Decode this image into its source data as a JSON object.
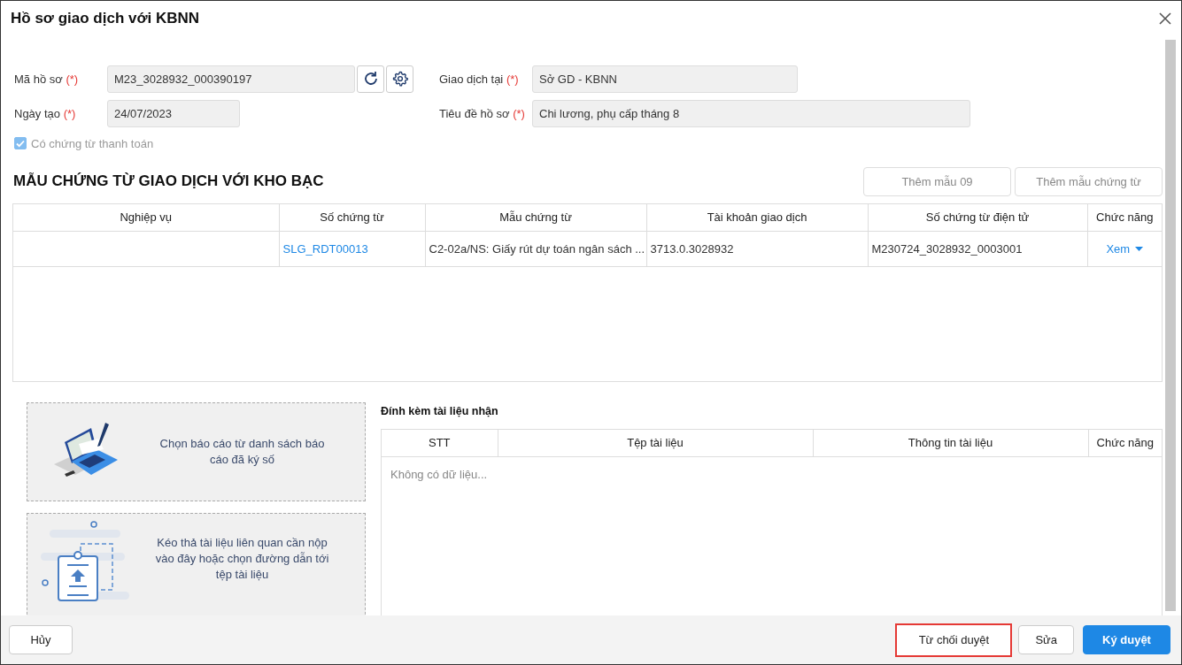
{
  "dialog": {
    "title": "Hồ sơ giao dịch với KBNN"
  },
  "form": {
    "fields": [
      {
        "label": "Mã hồ sơ",
        "required_mark": "(*)",
        "value": "M23_3028932_000390197",
        "kind": "with_actions"
      },
      {
        "label": "Giao dịch tại",
        "required_mark": "(*)",
        "value": "Sở GD - KBNN",
        "kind": "plain"
      },
      {
        "label": "Ngày tạo",
        "required_mark": "(*)",
        "value": "24/07/2023",
        "kind": "plain"
      },
      {
        "label": "Tiêu đề hồ sơ",
        "required_mark": "(*)",
        "value": "Chi lương, phụ cấp tháng 8",
        "kind": "plain"
      }
    ],
    "checkbox": {
      "label": "Có chứng từ thanh toán",
      "checked": true,
      "disabled": true
    }
  },
  "section": {
    "title": "MẪU CHỨNG TỪ GIAO DỊCH VỚI KHO BẠC",
    "buttons": [
      {
        "label": "Thêm mẫu 09",
        "disabled": true
      },
      {
        "label": "Thêm mẫu chứng từ",
        "disabled": true
      }
    ]
  },
  "voucher_table": {
    "columns": [
      "Nghiệp vụ",
      "Số chứng từ",
      "Mẫu chứng từ",
      "Tài khoản giao dịch",
      "Số chứng từ điện tử",
      "Chức năng"
    ],
    "rows": [
      {
        "cells": [
          {
            "kind": "empty"
          },
          {
            "kind": "link",
            "text": "SLG_RDT00013"
          },
          {
            "kind": "text",
            "text": "C2-02a/NS: Giấy rút dự toán ngân sách ..."
          },
          {
            "kind": "text",
            "text": "3713.0.3028932"
          },
          {
            "kind": "text",
            "text": "M230724_3028932_0003001"
          },
          {
            "kind": "action",
            "text": "Xem"
          }
        ]
      }
    ]
  },
  "upload_panels": [
    {
      "kind": "report",
      "text": "Chọn báo cáo từ danh sách báo cáo đã ký số"
    },
    {
      "kind": "upload",
      "text": "Kéo thả tài liệu liên quan cần nộp vào đây hoặc chọn đường dẫn tới tệp tài liệu"
    }
  ],
  "attachments": {
    "title": "Đính kèm tài liệu nhận",
    "columns": [
      "STT",
      "Tệp tài liệu",
      "Thông tin tài liệu",
      "Chức năng"
    ],
    "empty_text": "Không có dữ liệu..."
  },
  "footer": {
    "buttons": [
      {
        "label": "Hủy",
        "kind": "default",
        "highlighted": false
      },
      {
        "label": "Từ chối duyệt",
        "kind": "default",
        "highlighted": true
      },
      {
        "label": "Sửa",
        "kind": "default",
        "highlighted": false
      },
      {
        "label": "Ký duyệt",
        "kind": "primary",
        "highlighted": false
      }
    ]
  }
}
